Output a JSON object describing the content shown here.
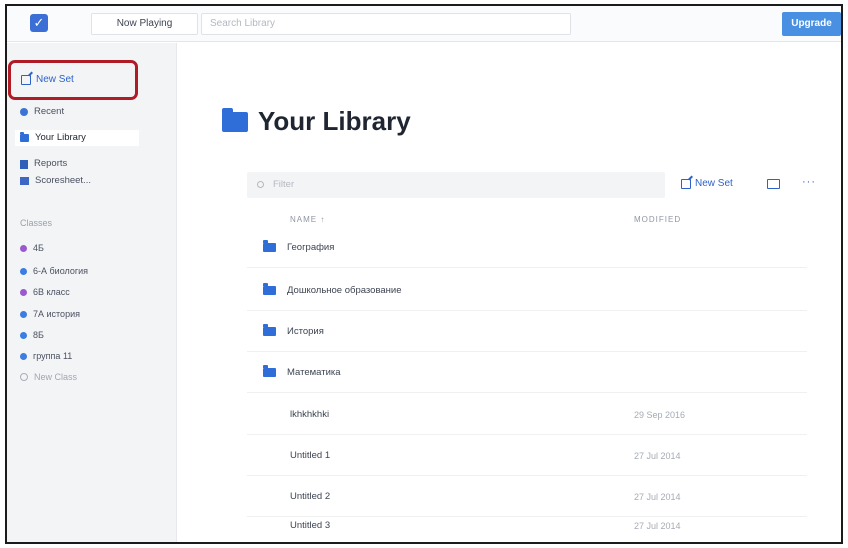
{
  "topbar": {
    "now_playing": "Now Playing",
    "search_placeholder": "Search Library",
    "upgrade": "Upgrade"
  },
  "sidebar": {
    "new_set": "New Set",
    "items": [
      {
        "label": "Recent",
        "icon": "recent-icon"
      },
      {
        "label": "Your Library",
        "icon": "folder-icon",
        "active": true
      },
      {
        "label": "Reports",
        "icon": "report-icon"
      },
      {
        "label": "Scoresheet...",
        "icon": "scoresheet-icon"
      }
    ],
    "classes_header": "Classes",
    "classes": [
      {
        "label": "4Б",
        "color": "#9b59d0"
      },
      {
        "label": "6-А биология",
        "color": "#3b7de0"
      },
      {
        "label": "6В класс",
        "color": "#9b59d0"
      },
      {
        "label": "7А история",
        "color": "#3b7de0"
      },
      {
        "label": "8Б",
        "color": "#3b7de0"
      },
      {
        "label": "группа 11",
        "color": "#3b7de0"
      }
    ],
    "new_class": "New Class"
  },
  "main": {
    "title": "Your Library",
    "filter_placeholder": "Filter",
    "toolbar_new_set": "New Set",
    "more": "···",
    "col_name": "NAME ↑",
    "col_modified": "MODIFIED",
    "folders": [
      "География",
      "Дошкольное образование",
      "История",
      "Математика"
    ],
    "sets": [
      {
        "name": "lkhkhkhki",
        "modified": "29 Sep 2016"
      },
      {
        "name": "Untitled 1",
        "modified": "27 Jul 2014"
      },
      {
        "name": "Untitled 2",
        "modified": "27 Jul 2014"
      },
      {
        "name": "Untitled 3",
        "modified": "27 Jul 2014"
      }
    ]
  },
  "colors": {
    "accent": "#2e62c9",
    "upgrade_bg": "#4a90e2",
    "highlight_box": "#b01c25"
  }
}
